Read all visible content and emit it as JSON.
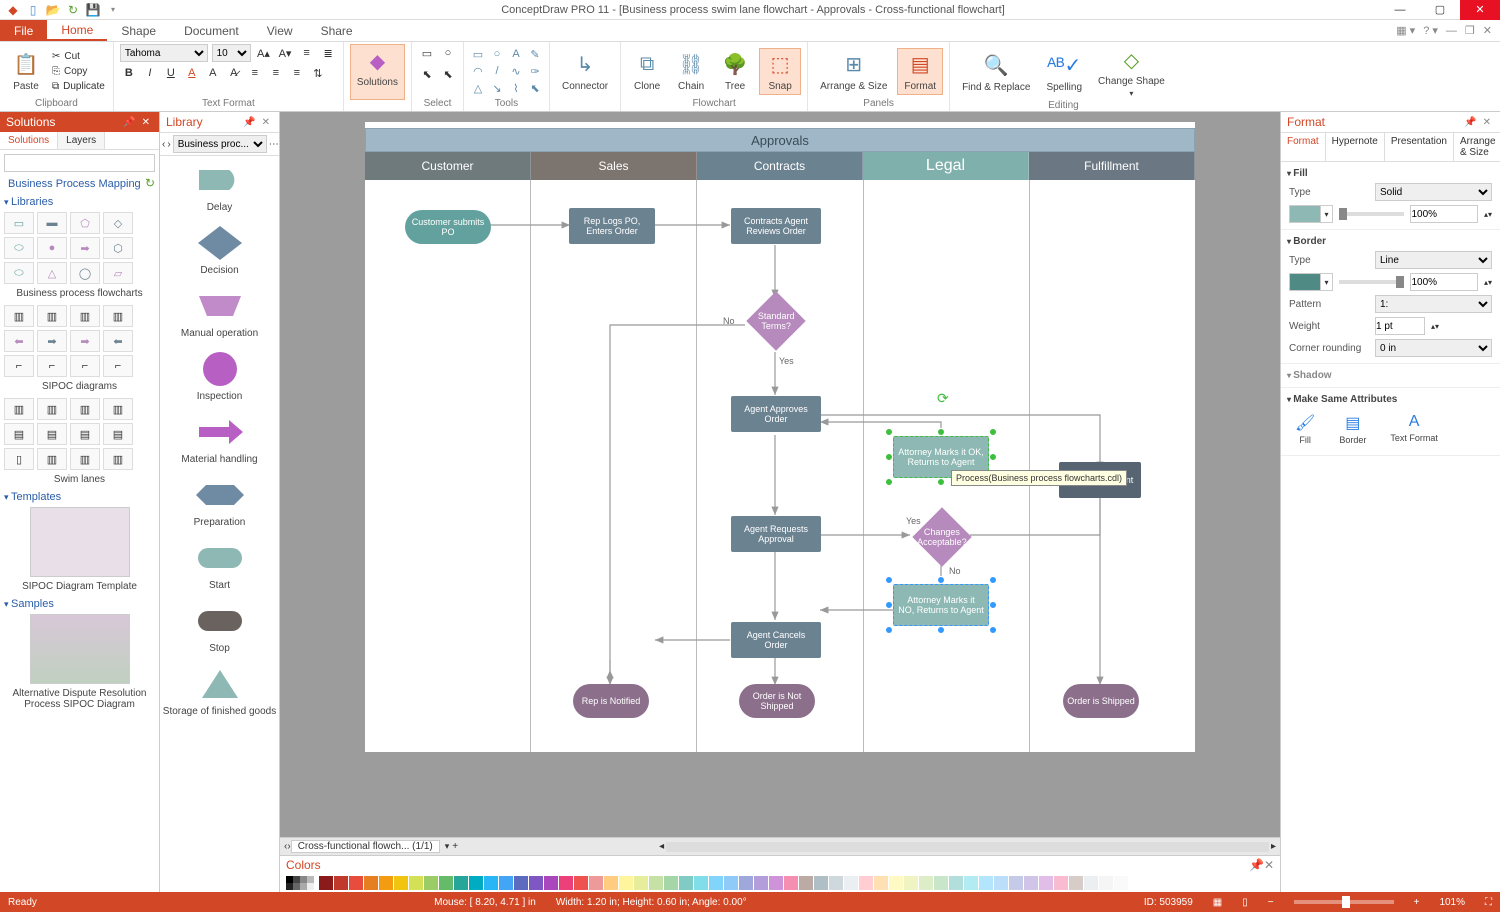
{
  "title": "ConceptDraw PRO 11 - [Business process swim lane flowchart - Approvals - Cross-functional flowchart]",
  "qat_icons": [
    "app",
    "doc",
    "open",
    "refresh",
    "save",
    "fwd"
  ],
  "tabs": {
    "file": "File",
    "items": [
      "Home",
      "Shape",
      "Document",
      "View",
      "Share"
    ],
    "active": "Home"
  },
  "ribbon": {
    "clipboard": {
      "paste": "Paste",
      "cut": "Cut",
      "copy": "Copy",
      "dup": "Duplicate",
      "label": "Clipboard"
    },
    "textfmt": {
      "font": "Tahoma",
      "size": "10",
      "label": "Text Format"
    },
    "solutions_btn": "Solutions",
    "select": {
      "label": "Select"
    },
    "tools": {
      "label": "Tools"
    },
    "connector": "Connector",
    "flowchart": {
      "clone": "Clone",
      "chain": "Chain",
      "tree": "Tree",
      "snap": "Snap",
      "label": "Flowchart"
    },
    "panels": {
      "arrange": "Arrange & Size",
      "format": "Format",
      "label": "Panels"
    },
    "editing": {
      "find": "Find & Replace",
      "spell": "Spelling",
      "change": "Change Shape",
      "label": "Editing"
    }
  },
  "solutions": {
    "title": "Solutions",
    "tabs": [
      "Solutions",
      "Layers"
    ],
    "root": "Business Process Mapping",
    "sections": {
      "libraries": {
        "title": "Libraries",
        "items": [
          "Business process flowcharts",
          "SIPOC diagrams",
          "Swim lanes"
        ]
      },
      "templates": {
        "title": "Templates",
        "items": [
          "SIPOC Diagram Template"
        ]
      },
      "samples": {
        "title": "Samples",
        "items": [
          "Alternative Dispute Resolution Process SIPOC Diagram"
        ]
      }
    }
  },
  "library": {
    "title": "Library",
    "set": "Business proc...",
    "items": [
      "Delay",
      "Decision",
      "Manual operation",
      "Inspection",
      "Material handling",
      "Preparation",
      "Start",
      "Stop",
      "Storage of finished goods"
    ]
  },
  "diagram": {
    "title": "Approvals",
    "lanes": [
      {
        "name": "Customer",
        "bg": "#6f7a7d"
      },
      {
        "name": "Sales",
        "bg": "#7c746e"
      },
      {
        "name": "Contracts",
        "bg": "#6b8291"
      },
      {
        "name": "Legal",
        "bg": "#7fb0ab",
        "big": true
      },
      {
        "name": "Fulfillment",
        "bg": "#6b7884"
      }
    ],
    "nodes": {
      "n1": "Customer submits PO",
      "n2": "Rep Logs PO, Enters Order",
      "n3": "Contracts Agent Reviews Order",
      "n4": "Standard Terms?",
      "n5": "Agent Approves Order",
      "n6": "Attorney Marks it OK, Returns to Agent",
      "n7": "Order Fulfillment",
      "n8": "Agent Requests Approval",
      "n9": "Changes Acceptable?",
      "n10": "Attorney Marks it NO, Returns to Agent",
      "n11": "Agent Cancels Order",
      "n12": "Rep is Notified",
      "n13": "Order is Not Shipped",
      "n14": "Order is Shipped"
    },
    "labels": {
      "yes": "Yes",
      "no": "No"
    },
    "tooltip": "Process(Business process flowcharts.cdl)"
  },
  "sheet": "Cross-functional flowch... (1/1)",
  "colors_title": "Colors",
  "format": {
    "title": "Format",
    "tabs": [
      "Format",
      "Hypernote",
      "Presentation",
      "Arrange & Size"
    ],
    "fill": {
      "h": "Fill",
      "type_l": "Type",
      "type_v": "Solid",
      "opacity": "100%",
      "chip": "#8db8b3"
    },
    "border": {
      "h": "Border",
      "type_l": "Type",
      "type_v": "Line",
      "opacity": "100%",
      "pattern_l": "Pattern",
      "pattern_v": "1:",
      "weight_l": "Weight",
      "weight_v": "1 pt",
      "corner_l": "Corner rounding",
      "corner_v": "0 in",
      "chip": "#4f8a84"
    },
    "shadow": {
      "h": "Shadow"
    },
    "same": {
      "h": "Make Same Attributes",
      "btns": [
        "Fill",
        "Border",
        "Text Format"
      ]
    }
  },
  "status": {
    "ready": "Ready",
    "mouse": "Mouse: [ 8.20, 4.71 ] in",
    "dims": "Width: 1.20 in;  Height: 0.60 in;  Angle: 0.00°",
    "id": "ID: 503959",
    "zoom": "101%"
  }
}
